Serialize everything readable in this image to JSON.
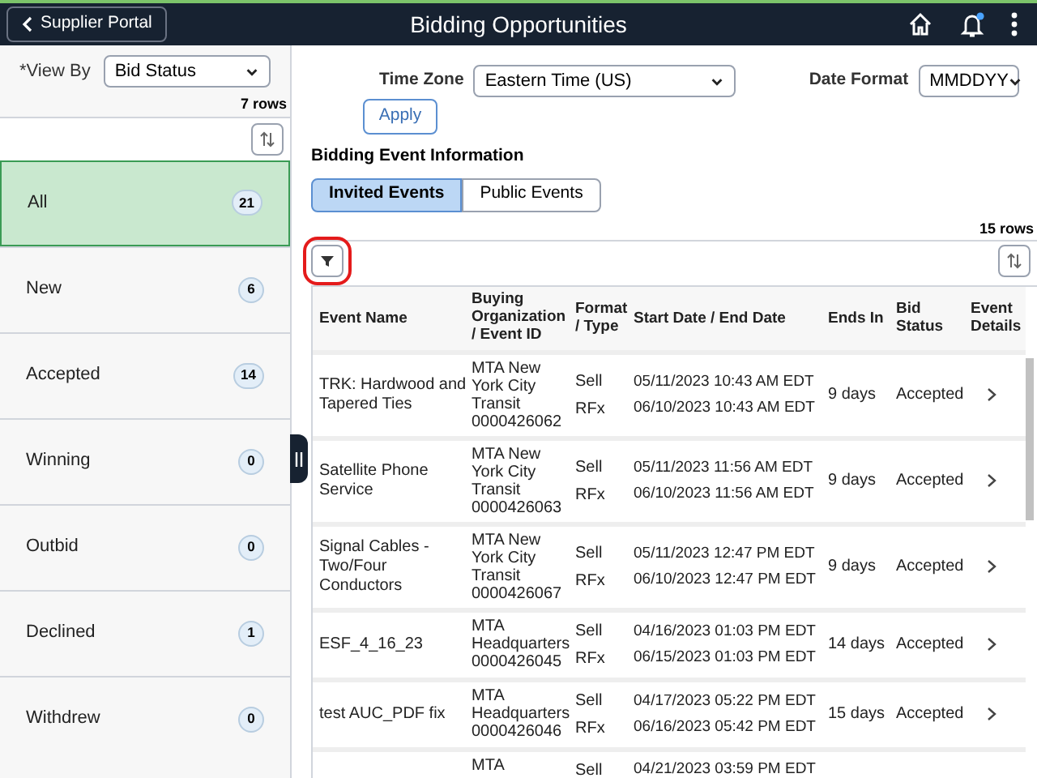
{
  "header": {
    "back_button": "Supplier Portal",
    "title": "Bidding Opportunities",
    "has_notifications": true
  },
  "sidebar": {
    "view_by_label": "*View By",
    "view_by_value": "Bid Status",
    "row_count": "7 rows",
    "items": [
      {
        "label": "All",
        "count": "21",
        "selected": true
      },
      {
        "label": "New",
        "count": "6",
        "selected": false
      },
      {
        "label": "Accepted",
        "count": "14",
        "selected": false
      },
      {
        "label": "Winning",
        "count": "0",
        "selected": false
      },
      {
        "label": "Outbid",
        "count": "0",
        "selected": false
      },
      {
        "label": "Declined",
        "count": "1",
        "selected": false
      },
      {
        "label": "Withdrew",
        "count": "0",
        "selected": false
      }
    ]
  },
  "filters": {
    "time_zone_label": "Time Zone",
    "time_zone_value": "Eastern Time (US)",
    "date_format_label": "Date Format",
    "date_format_value": "MMDDYY",
    "apply_button": "Apply"
  },
  "section_title": "Bidding Event Information",
  "tabs": [
    {
      "label": "Invited Events",
      "selected": true
    },
    {
      "label": "Public Events",
      "selected": false
    }
  ],
  "table": {
    "row_count": "15 rows",
    "columns": [
      "Event Name",
      "Buying Organization / Event ID",
      "Format / Type",
      "Start Date / End Date",
      "Ends In",
      "Bid Status",
      "Event Details"
    ],
    "rows": [
      {
        "event_name": "TRK: Hardwood and Tapered Ties",
        "organization": "MTA New York City Transit",
        "event_id": "0000426062",
        "format": "Sell",
        "type": "RFx",
        "start_date": "05/11/2023 10:43 AM EDT",
        "end_date": "06/10/2023 10:43 AM EDT",
        "ends_in": "9 days",
        "bid_status": "Accepted"
      },
      {
        "event_name": "Satellite Phone Service",
        "organization": "MTA New York City Transit",
        "event_id": "0000426063",
        "format": "Sell",
        "type": "RFx",
        "start_date": "05/11/2023 11:56 AM EDT",
        "end_date": "06/10/2023 11:56 AM EDT",
        "ends_in": "9 days",
        "bid_status": "Accepted"
      },
      {
        "event_name": "Signal Cables - Two/Four Conductors",
        "organization": "MTA New York City Transit",
        "event_id": "0000426067",
        "format": "Sell",
        "type": "RFx",
        "start_date": "05/11/2023 12:47 PM EDT",
        "end_date": "06/10/2023 12:47 PM EDT",
        "ends_in": "9 days",
        "bid_status": "Accepted"
      },
      {
        "event_name": "ESF_4_16_23",
        "organization": "MTA Headquarters",
        "event_id": "0000426045",
        "format": "Sell",
        "type": "RFx",
        "start_date": "04/16/2023 01:03 PM EDT",
        "end_date": "06/15/2023 01:03 PM EDT",
        "ends_in": "14 days",
        "bid_status": "Accepted"
      },
      {
        "event_name": "test AUC_PDF fix",
        "organization": "MTA Headquarters",
        "event_id": "0000426046",
        "format": "Sell",
        "type": "RFx",
        "start_date": "04/17/2023 05:22 PM EDT",
        "end_date": "06/16/2023 05:42 PM EDT",
        "ends_in": "15 days",
        "bid_status": "Accepted"
      },
      {
        "organization": "MTA",
        "format": "Sell",
        "start_date": "04/21/2023 03:59 PM EDT"
      }
    ]
  }
}
